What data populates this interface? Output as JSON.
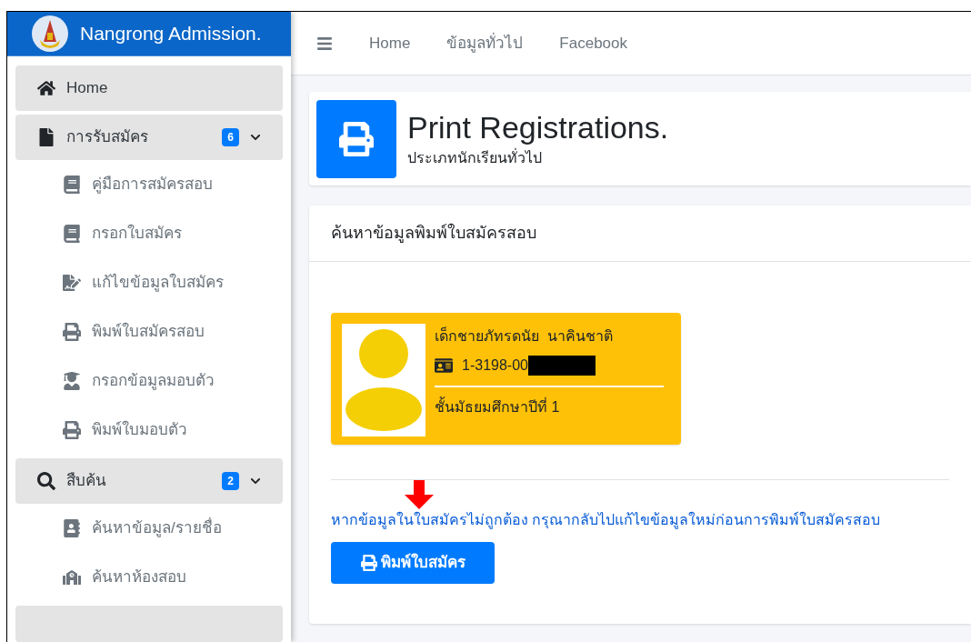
{
  "brand": {
    "title": "Nangrong Admission."
  },
  "topnav": {
    "items": [
      {
        "label": "Home"
      },
      {
        "label": "ข้อมูลทั่วไป"
      },
      {
        "label": "Facebook"
      }
    ]
  },
  "sidebar": {
    "items": [
      {
        "kind": "link",
        "label": "Home"
      },
      {
        "kind": "group",
        "label": "การรับสมัคร",
        "badge": "6",
        "expanded": true,
        "children": [
          {
            "label": "คู่มือการสมัครสอบ"
          },
          {
            "label": "กรอกใบสมัคร"
          },
          {
            "label": "แก้ไขข้อมูลใบสมัคร"
          },
          {
            "label": "พิมพ์ใบสมัครสอบ"
          },
          {
            "label": "กรอกข้อมูลมอบตัว"
          },
          {
            "label": "พิมพ์ใบมอบตัว"
          }
        ]
      },
      {
        "kind": "group",
        "label": "สืบค้น",
        "badge": "2",
        "expanded": true,
        "children": [
          {
            "label": "ค้นหาข้อมูล/รายชื่อ"
          },
          {
            "label": "ค้นหาห้องสอบ"
          }
        ]
      },
      {
        "kind": "stub"
      }
    ]
  },
  "page_header": {
    "title": "Print Registrations.",
    "subtitle": "ประเภทนักเรียนทั่วไป"
  },
  "search_card": {
    "title": "ค้นหาข้อมูลพิมพ์ใบสมัครสอบ",
    "student": {
      "name": "เด็กชายภัทรดนัย  นาคินชาติ",
      "id_number": "1-3198-00",
      "id_redacted": true,
      "grade": "ชั้นมัธยมศึกษาปีที่ 1"
    },
    "notice": "หากข้อมูลในใบสมัครไม่ถูกต้อง กรุณากลับไปแก้ไขข้อมูลใหม่ก่อนการพิมพ์ใบสมัครสอบ",
    "print_button": "พิมพ์ใบสมัคร"
  }
}
